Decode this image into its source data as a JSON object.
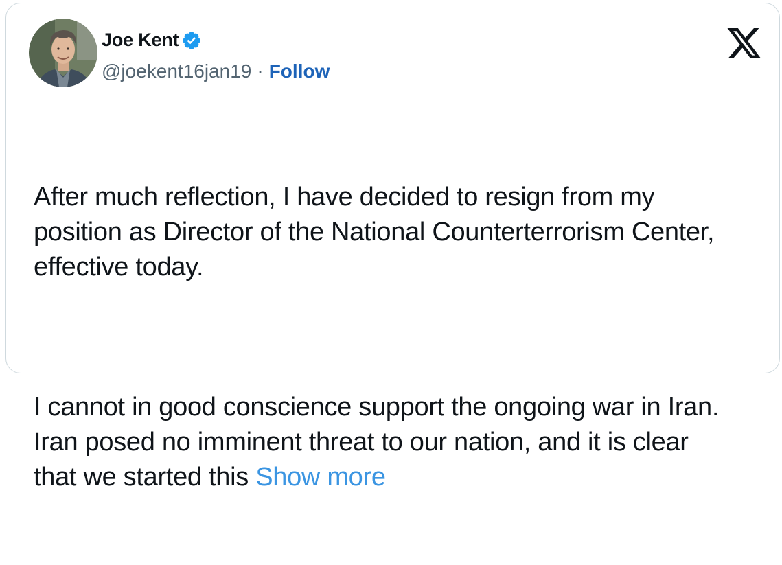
{
  "author": {
    "display_name": "Joe Kent",
    "handle": "@joekent16jan19",
    "separator": "·",
    "follow_label": "Follow",
    "verified_icon": "verified-badge-icon",
    "avatar_icon": "profile-photo"
  },
  "brand": {
    "logo_icon": "x-logo-icon"
  },
  "tweet": {
    "paragraph_1_lines": [
      "After much reflection, I have decided to resign from my",
      "position as Director of the National Counterterrorism Center,",
      "effective today."
    ],
    "paragraph_2_lines": [
      "I cannot in good conscience support the ongoing war in Iran.",
      "Iran posed no imminent threat to our nation, and it is clear",
      "that we started this "
    ],
    "show_more_label": "Show more"
  },
  "colors": {
    "text": "#0f1419",
    "secondary_text": "#536471",
    "follow_link": "#1d63b8",
    "show_more_link": "#3b95e2",
    "verified_blue": "#1d9bf0",
    "border": "#cfd9de"
  }
}
